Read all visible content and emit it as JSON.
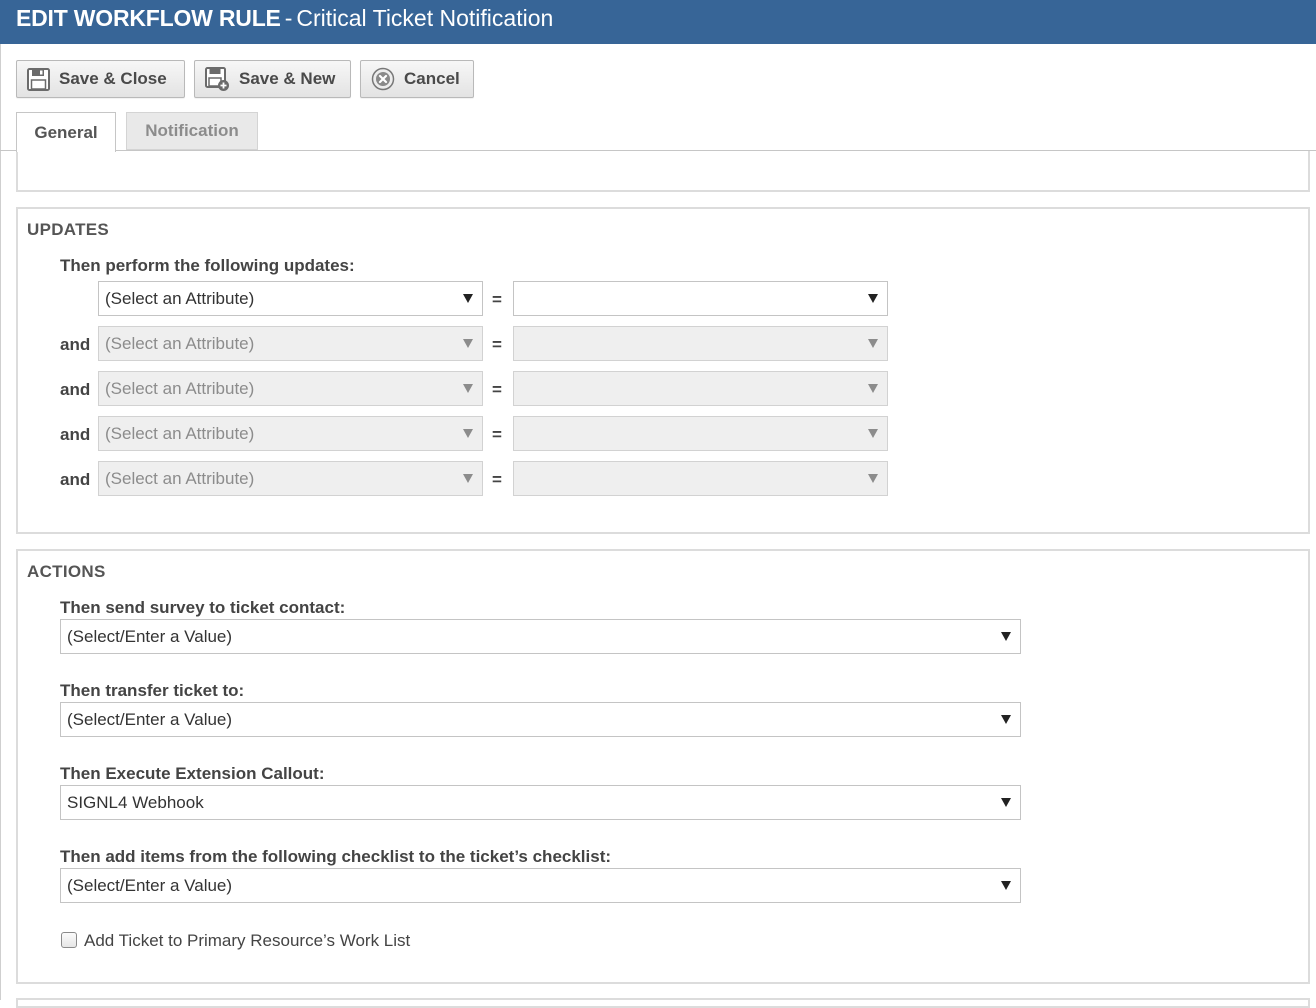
{
  "window": {
    "title_bold": "EDIT WORKFLOW RULE",
    "title_sep": "-",
    "title_rest": "Critical Ticket Notification"
  },
  "toolbar": {
    "save_close": "Save & Close",
    "save_new": "Save & New",
    "cancel": "Cancel"
  },
  "tabs": [
    {
      "label": "General",
      "active": true
    },
    {
      "label": "Notification",
      "active": false
    }
  ],
  "updates": {
    "title": "UPDATES",
    "prompt": "Then perform the following updates:",
    "equals": "=",
    "rows": [
      {
        "conj": "",
        "attribute": "(Select an Attribute)",
        "value": "",
        "enabled": true
      },
      {
        "conj": "and",
        "attribute": "(Select an Attribute)",
        "value": "",
        "enabled": false
      },
      {
        "conj": "and",
        "attribute": "(Select an Attribute)",
        "value": "",
        "enabled": false
      },
      {
        "conj": "and",
        "attribute": "(Select an Attribute)",
        "value": "",
        "enabled": false
      },
      {
        "conj": "and",
        "attribute": "(Select an Attribute)",
        "value": "",
        "enabled": false
      }
    ]
  },
  "actions": {
    "title": "ACTIONS",
    "survey": {
      "label": "Then send survey to ticket contact:",
      "value": "(Select/Enter a Value)"
    },
    "transfer": {
      "label": "Then transfer ticket to:",
      "value": "(Select/Enter a Value)"
    },
    "callout": {
      "label": "Then Execute Extension Callout:",
      "value": "SIGNL4 Webhook"
    },
    "checklist": {
      "label": "Then add items from the following checklist to the ticket’s checklist:",
      "value": "(Select/Enter a Value)"
    },
    "worklist": {
      "label": "Add Ticket to Primary Resource’s Work List",
      "checked": false
    }
  }
}
